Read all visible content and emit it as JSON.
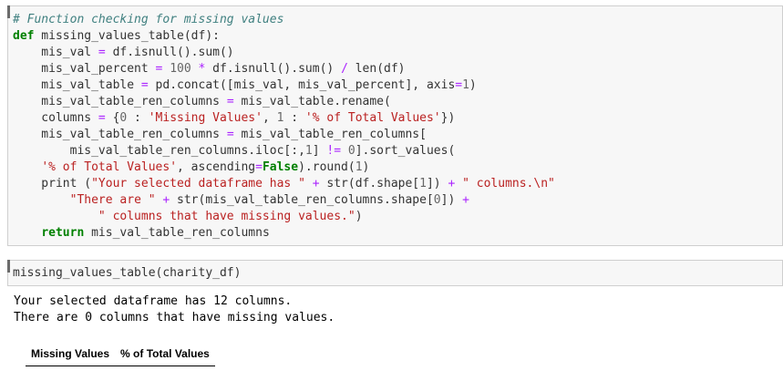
{
  "cells": [
    {
      "lines": [
        [
          [
            "c",
            "# Function checking for missing values"
          ]
        ],
        [
          [
            "k",
            "def"
          ],
          [
            "n",
            " missing_values_table(df):"
          ]
        ],
        [
          [
            "n",
            "    mis_val "
          ],
          [
            "o",
            "="
          ],
          [
            "n",
            " df.isnull().sum()"
          ]
        ],
        [
          [
            "n",
            "    mis_val_percent "
          ],
          [
            "o",
            "="
          ],
          [
            "n",
            " "
          ],
          [
            "m",
            "100"
          ],
          [
            "n",
            " "
          ],
          [
            "o",
            "*"
          ],
          [
            "n",
            " df.isnull().sum() "
          ],
          [
            "o",
            "/"
          ],
          [
            "n",
            " len(df)"
          ]
        ],
        [
          [
            "n",
            "    mis_val_table "
          ],
          [
            "o",
            "="
          ],
          [
            "n",
            " pd.concat([mis_val, mis_val_percent], axis"
          ],
          [
            "o",
            "="
          ],
          [
            "m",
            "1"
          ],
          [
            "n",
            ")"
          ]
        ],
        [
          [
            "n",
            "    mis_val_table_ren_columns "
          ],
          [
            "o",
            "="
          ],
          [
            "n",
            " mis_val_table.rename("
          ]
        ],
        [
          [
            "n",
            "    columns "
          ],
          [
            "o",
            "="
          ],
          [
            "n",
            " {"
          ],
          [
            "m",
            "0"
          ],
          [
            "n",
            " : "
          ],
          [
            "s",
            "'Missing Values'"
          ],
          [
            "n",
            ", "
          ],
          [
            "m",
            "1"
          ],
          [
            "n",
            " : "
          ],
          [
            "s",
            "'% of Total Values'"
          ],
          [
            "n",
            "})"
          ]
        ],
        [
          [
            "n",
            "    mis_val_table_ren_columns "
          ],
          [
            "o",
            "="
          ],
          [
            "n",
            " mis_val_table_ren_columns["
          ]
        ],
        [
          [
            "n",
            "        mis_val_table_ren_columns.iloc[:,"
          ],
          [
            "m",
            "1"
          ],
          [
            "n",
            "] "
          ],
          [
            "o",
            "!="
          ],
          [
            "n",
            " "
          ],
          [
            "m",
            "0"
          ],
          [
            "n",
            "].sort_values("
          ]
        ],
        [
          [
            "n",
            "    "
          ],
          [
            "s",
            "'% of Total Values'"
          ],
          [
            "n",
            ", ascending"
          ],
          [
            "o",
            "="
          ],
          [
            "k",
            "False"
          ],
          [
            "n",
            ").round("
          ],
          [
            "m",
            "1"
          ],
          [
            "n",
            ")"
          ]
        ],
        [
          [
            "n",
            "    print ("
          ],
          [
            "s",
            "\"Your selected dataframe has \""
          ],
          [
            "n",
            " "
          ],
          [
            "o",
            "+"
          ],
          [
            "n",
            " str(df.shape["
          ],
          [
            "m",
            "1"
          ],
          [
            "n",
            "]) "
          ],
          [
            "o",
            "+"
          ],
          [
            "n",
            " "
          ],
          [
            "s",
            "\" columns.\\n\""
          ]
        ],
        [
          [
            "n",
            "        "
          ],
          [
            "s",
            "\"There are \""
          ],
          [
            "n",
            " "
          ],
          [
            "o",
            "+"
          ],
          [
            "n",
            " str(mis_val_table_ren_columns.shape["
          ],
          [
            "m",
            "0"
          ],
          [
            "n",
            "]) "
          ],
          [
            "o",
            "+"
          ]
        ],
        [
          [
            "n",
            "            "
          ],
          [
            "s",
            "\" columns that have missing values.\""
          ],
          [
            "n",
            ")"
          ]
        ],
        [
          [
            "n",
            "    "
          ],
          [
            "k",
            "return"
          ],
          [
            "n",
            " mis_val_table_ren_columns"
          ]
        ]
      ]
    },
    {
      "lines": [
        [
          [
            "n",
            "missing_values_table(charity_df)"
          ]
        ]
      ]
    }
  ],
  "output": {
    "line1": "Your selected dataframe has 12 columns.",
    "line2": "There are 0 columns that have missing values."
  },
  "table": {
    "headers": [
      "Missing Values",
      "% of Total Values"
    ]
  },
  "colors": {
    "comment": "#408080",
    "keyword": "#008000",
    "string": "#ba2121",
    "number": "#666666",
    "operator": "#aa22ff",
    "cell_background": "#f7f7f7",
    "cell_border": "#cfcfcf"
  }
}
